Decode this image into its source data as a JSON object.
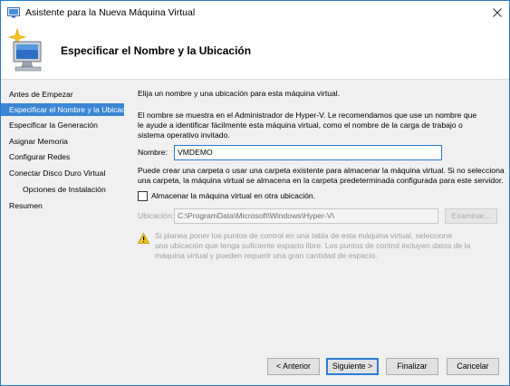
{
  "window": {
    "title": "Asistente para la Nueva Máquina Virtual",
    "close_glyph": "✕"
  },
  "header": {
    "title": "Especificar el Nombre y la Ubicación",
    "icon": "wizard-computer-icon"
  },
  "nav": {
    "items": [
      {
        "label": "Antes de Empezar",
        "active": false,
        "sub": false
      },
      {
        "label": "Especificar el Nombre y la Ubicación",
        "active": true,
        "sub": false
      },
      {
        "label": "Especificar la Generación",
        "active": false,
        "sub": false
      },
      {
        "label": "Asignar Memoria",
        "active": false,
        "sub": false
      },
      {
        "label": "Configurar Redes",
        "active": false,
        "sub": false
      },
      {
        "label": "Conectar Disco Duro Virtual",
        "active": false,
        "sub": false
      },
      {
        "label": "Opciones de Instalación",
        "active": false,
        "sub": true
      },
      {
        "label": "Resumen",
        "active": false,
        "sub": false
      }
    ]
  },
  "content": {
    "intro": "Elija un nombre y una ubicación para esta máquina virtual.",
    "description_line1": "El nombre se muestra en el Administrador de Hyper-V. Le recomendamos que use un nombre que",
    "description_line2": "le ayude a identificar fácilmente esta máquina virtual, como el nombre de la carga de trabajo o",
    "description_line3": "sistema operativo invitado.",
    "name_label": "Nombre:",
    "name_value": "VMDEMO",
    "folder_line1": "Puede crear una carpeta o usar una carpeta existente para almacenar la máquina virtual. Si no selecciona",
    "folder_line2": "una carpeta, la máquina virtual se almacena en la carpeta predeterminada configurada para este servidor.",
    "store_checkbox_label": "Almacenar la máquina virtual en otra ubicación.",
    "store_checked": false,
    "location_label": "Ubicación:",
    "location_value": "C:\\ProgramData\\Microsoft\\Windows\\Hyper-V\\",
    "browse_label": "Examinar...",
    "warning_line1": "Si planea poner los puntos de control en una tabla de esta máquina virtual, seleccione",
    "warning_line2": "una ubicación que tenga suficiente espacio libre. Los puntos de control incluyen datos de la",
    "warning_line3": "máquina virtual y pueden requerir una gran cantidad de espacio."
  },
  "buttons": {
    "previous": "< Anterior",
    "next": "Siguiente >",
    "finish": "Finalizar",
    "cancel": "Cancelar"
  },
  "colors": {
    "accent": "#3a86d4",
    "focus_border": "#2b7bd3",
    "disabled_text": "#a0a0a0"
  }
}
